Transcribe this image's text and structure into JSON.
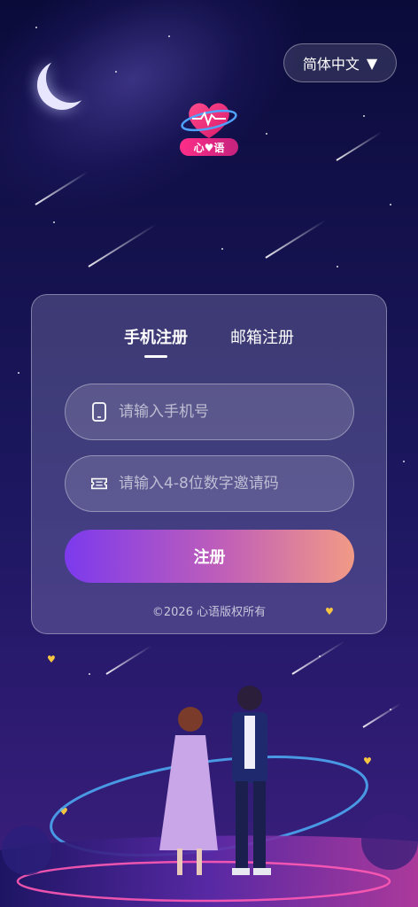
{
  "header": {
    "language_label": "简体中文",
    "language_icon": "triangle-down-icon"
  },
  "logo": {
    "icon": "heart-planet-icon",
    "text": "心♥语"
  },
  "tabs": [
    {
      "label": "手机注册",
      "active": true
    },
    {
      "label": "邮箱注册",
      "active": false
    }
  ],
  "form": {
    "phone_placeholder": "请输入手机号",
    "phone_icon": "phone-icon",
    "invite_placeholder": "请输入4-8位数字邀请码",
    "invite_icon": "ticket-icon",
    "submit_label": "注册"
  },
  "footer": {
    "copyright": "©2026 心语版权所有"
  },
  "colors": {
    "button_start": "#7c3aed",
    "button_end": "#f29a86",
    "background_top": "#0b0b3a",
    "accent_heart": "#f5c542"
  }
}
